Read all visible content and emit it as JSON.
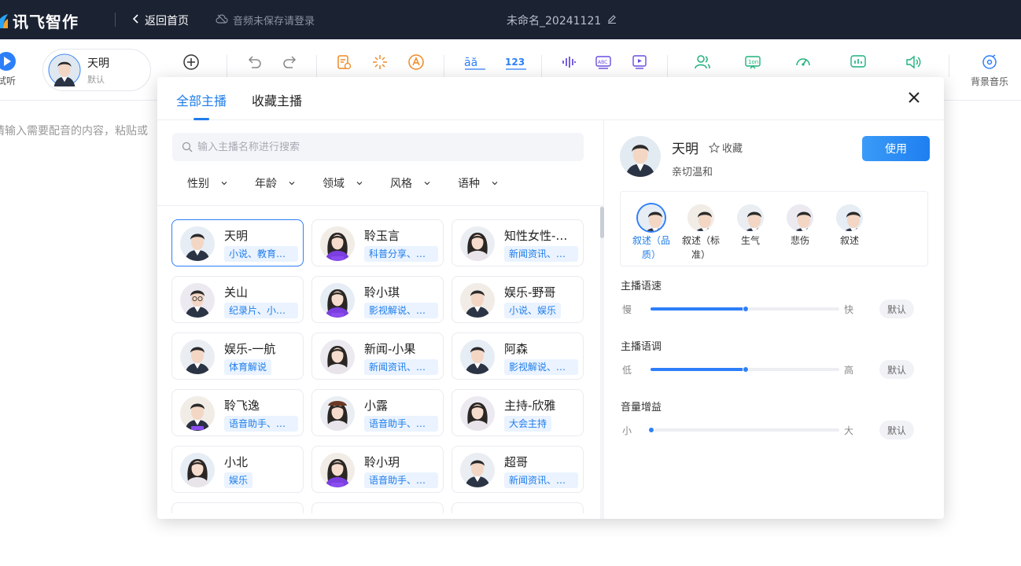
{
  "topbar": {
    "logo_text": "讯飞智作",
    "back_label": "返回首页",
    "save_tip": "音频未保存请登录",
    "doc_title": "未命名_20241121"
  },
  "toolbar": {
    "trial_label": "试听",
    "current_anchor": {
      "name": "天明",
      "sub": "默认"
    },
    "bgm_label": "背景音乐"
  },
  "editor": {
    "placeholder": "请输入需要配音的内容，粘贴或"
  },
  "modal": {
    "tabs": [
      "全部主播",
      "收藏主播"
    ],
    "active_tab": "全部主播",
    "search_placeholder": "输入主播名称进行搜索",
    "filters": [
      "性别",
      "年龄",
      "领域",
      "风格",
      "语种"
    ],
    "anchors": [
      {
        "name": "天明",
        "tag": "小说、教育培…",
        "avatar": "male"
      },
      {
        "name": "聆玉言",
        "tag": "科普分享、情…",
        "avatar": "female-badge"
      },
      {
        "name": "知性女性-…",
        "tag": "新闻资讯、教…",
        "avatar": "female"
      },
      {
        "name": "关山",
        "tag": "纪录片、小说…",
        "avatar": "male-glasses"
      },
      {
        "name": "聆小琪",
        "tag": "影视解说、教…",
        "avatar": "female-badge"
      },
      {
        "name": "娱乐-野哥",
        "tag": "小说、娱乐",
        "avatar": "male"
      },
      {
        "name": "娱乐-一航",
        "tag": "体育解说",
        "avatar": "male"
      },
      {
        "name": "新闻-小果",
        "tag": "新闻资讯、教…",
        "avatar": "female"
      },
      {
        "name": "阿森",
        "tag": "影视解说、体…",
        "avatar": "male"
      },
      {
        "name": "聆飞逸",
        "tag": "语音助手、科…",
        "avatar": "male-badge"
      },
      {
        "name": "小露",
        "tag": "语音助手、广…",
        "avatar": "female-hat"
      },
      {
        "name": "主持-欣雅",
        "tag": "大会主持",
        "avatar": "female"
      },
      {
        "name": "小北",
        "tag": "娱乐",
        "avatar": "female"
      },
      {
        "name": "聆小玥",
        "tag": "语音助手、情…",
        "avatar": "female-badge"
      },
      {
        "name": "超哥",
        "tag": "新闻资讯、教…",
        "avatar": "male-suit"
      }
    ],
    "detail": {
      "name": "天明",
      "fav_label": "收藏",
      "desc": "亲切温和",
      "use_label": "使用",
      "styles": [
        {
          "label": "叙述（品质）",
          "active": true
        },
        {
          "label": "叙述（标准）",
          "active": false
        },
        {
          "label": "生气",
          "active": false
        },
        {
          "label": "悲伤",
          "active": false
        },
        {
          "label": "叙述",
          "active": false
        }
      ],
      "params": [
        {
          "title": "主播语速",
          "low": "慢",
          "high": "快",
          "value": 0.5,
          "default_label": "默认"
        },
        {
          "title": "主播语调",
          "low": "低",
          "high": "高",
          "value": 0.5,
          "default_label": "默认"
        },
        {
          "title": "音量增益",
          "low": "小",
          "high": "大",
          "value": 0.0,
          "default_label": "默认"
        }
      ]
    }
  },
  "colors": {
    "accent": "#1f7dea",
    "topbar": "#1b2232"
  }
}
